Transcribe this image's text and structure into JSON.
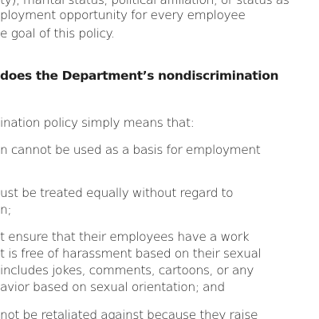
{
  "intro_paragraph": {
    "lines": [
      "ty), marital status, political affiliation, or status as",
      "ployment opportunity for every employee",
      "e goal of this policy."
    ]
  },
  "section_heading": "does the Department’s nondiscrimination",
  "body": {
    "lead_in": "ination policy simply means that:",
    "item_1": [
      "n cannot be used as a basis for employment"
    ],
    "item_2": [
      "ust be treated equally without regard to",
      "n;"
    ],
    "item_3": [
      "t ensure that their employees have a work",
      "t is free of harassment based on their sexual",
      "includes jokes, comments, cartoons, or any",
      "avior based on sexual orientation; and"
    ],
    "item_4": [
      "not be retaliated against because they raise"
    ]
  }
}
